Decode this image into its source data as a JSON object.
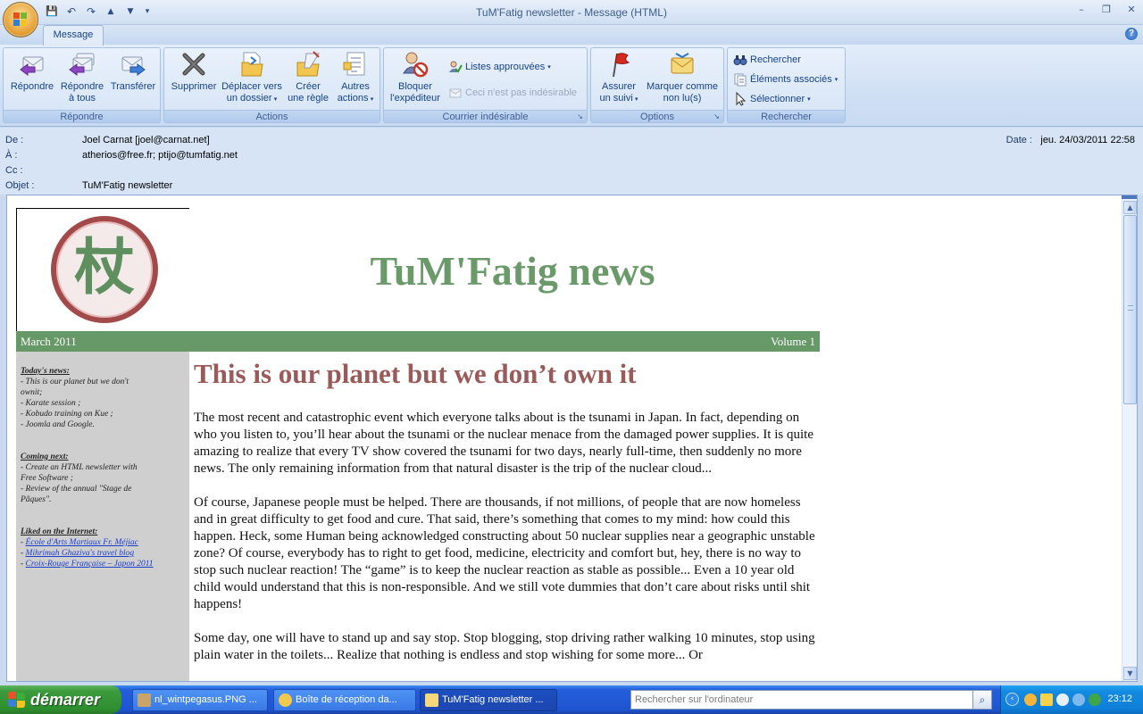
{
  "window": {
    "title": "TuM'Fatig newsletter  -  Message (HTML)",
    "minimize": "–",
    "maximize": "❐",
    "close": "✕"
  },
  "qat": {
    "save": "💾",
    "undo": "↶",
    "redo": "↷",
    "up": "▲",
    "down": "▼",
    "more": "▾"
  },
  "tabs": {
    "message": "Message"
  },
  "help": "?",
  "ribbon": {
    "groups": {
      "repondre": "Répondre",
      "actions": "Actions",
      "courrier": "Courrier indésirable",
      "options": "Options",
      "rechercher": "Rechercher"
    },
    "buttons": {
      "repondre_l1": "Répondre",
      "repondre_tous_l1": "Répondre",
      "repondre_tous_l2": "à tous",
      "transferer": "Transférer",
      "supprimer": "Supprimer",
      "deplacer_l1": "Déplacer vers",
      "deplacer_l2": "un dossier",
      "creer_l1": "Créer",
      "creer_l2": "une règle",
      "autres_l1": "Autres",
      "autres_l2": "actions",
      "bloquer_l1": "Bloquer",
      "bloquer_l2": "l'expéditeur",
      "listes": "Listes approuvées",
      "pas_indesirable": "Ceci n'est pas indésirable",
      "suivi_l1": "Assurer",
      "suivi_l2": "un suivi",
      "marquer_l1": "Marquer comme",
      "marquer_l2": "non lu(s)",
      "rechercher": "Rechercher",
      "elements": "Éléments associés",
      "selectionner": "Sélectionner"
    }
  },
  "headers": {
    "from_label": "De :",
    "from": "Joel Carnat [joel@carnat.net]",
    "to_label": "À :",
    "to": "atherios@free.fr; ptijo@tumfatig.net",
    "cc_label": "Cc :",
    "cc": "",
    "subject_label": "Objet :",
    "subject": "TuM'Fatig newsletter",
    "date_label": "Date :",
    "date": "jeu. 24/03/2011 22:58"
  },
  "newsletter": {
    "logo_char": "杖",
    "title": "TuM'Fatig news",
    "issue_date": "March 2011",
    "volume": "Volume 1",
    "sidebar": {
      "today_title": "Today's news:",
      "today_items": [
        "- This is our planet but we don't",
        "ownit;",
        "- Karate session ;",
        "- Kobudo training on Kue ;",
        "- Joomla and Google."
      ],
      "next_title": "Coming next:",
      "next_items": [
        "- Create an HTML newsletter with",
        "Free Software ;",
        "- Review of the annual \"Stage de",
        "Pâques\"."
      ],
      "liked_title": "Liked on the Internet:",
      "links": [
        "École d'Arts Martiaux Fr. Méjiac",
        "Mihrimah Ghaziva's travel blog",
        "Croix-Rouge Française – Japon 2011"
      ]
    },
    "headline": "This is our planet but we don’t own it",
    "paragraphs": [
      "The most recent and catastrophic event which everyone talks about is the tsunami in Japan. In fact, depending on who you listen to, you’ll hear about the tsunami or the nuclear menace from the damaged power supplies. It is quite amazing to realize that every TV show covered the tsunami for two days, nearly full-time, then suddenly no more news. The only remaining information from that natural disaster is the trip of the nuclear cloud...",
      "Of course, Japanese people must be helped. There are thousands, if not millions, of people that are now homeless and in great difficulty to get food and cure. That said, there’s something that comes to my mind: how could this happen. Heck, some Human being acknowledged constructing about 50 nuclear supplies near a geographic unstable zone? Of course, everybody has to right to get food, medicine, electricity and comfort but, hey, there is no way to stop such nuclear reaction! The “game” is to keep the nuclear reaction as stable as possible... Even a 10 year old child would understand that this is non-responsible. And we still vote dummies that don’t care about risks until shit happens!",
      "Some day, one will have to stand up and say stop. Stop blogging, stop driving rather walking 10 minutes, stop using plain water in the toilets... Realize that nothing is endless and stop wishing for some more... Or"
    ]
  },
  "taskbar": {
    "start": "démarrer",
    "tasks": [
      "nl_wintpegasus.PNG ...",
      "Boîte de réception da...",
      "TuM'Fatig newsletter ..."
    ],
    "search_placeholder": "Rechercher sur l'ordinateur",
    "clock": "23:12"
  }
}
